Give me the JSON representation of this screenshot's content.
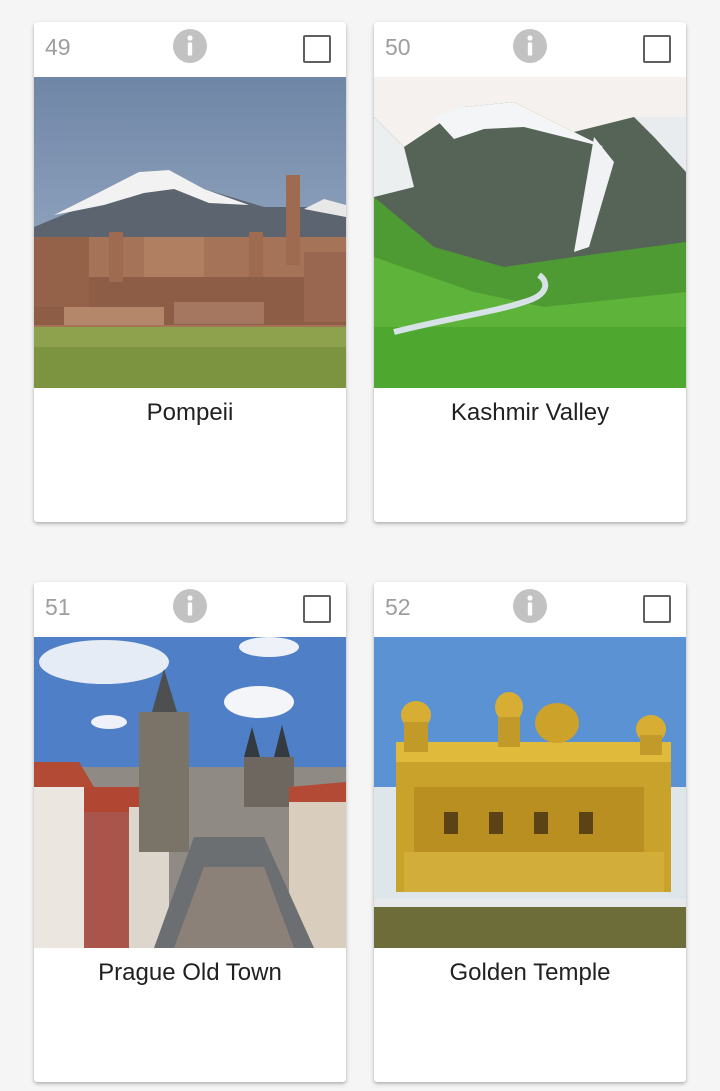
{
  "cards": [
    {
      "number": "49",
      "title": "Pompeii",
      "info_icon": "info-icon",
      "checked": false
    },
    {
      "number": "50",
      "title": "Kashmir Valley",
      "info_icon": "info-icon",
      "checked": false
    },
    {
      "number": "51",
      "title": "Prague Old Town",
      "info_icon": "info-icon",
      "checked": false
    },
    {
      "number": "52",
      "title": "Golden Temple",
      "info_icon": "info-icon",
      "checked": false
    }
  ],
  "colors": {
    "card_background": "#ffffff",
    "page_background": "#f5f5f5",
    "number_text": "#9e9e9e",
    "title_text": "#212121",
    "info_icon": "#c2c2c2"
  }
}
